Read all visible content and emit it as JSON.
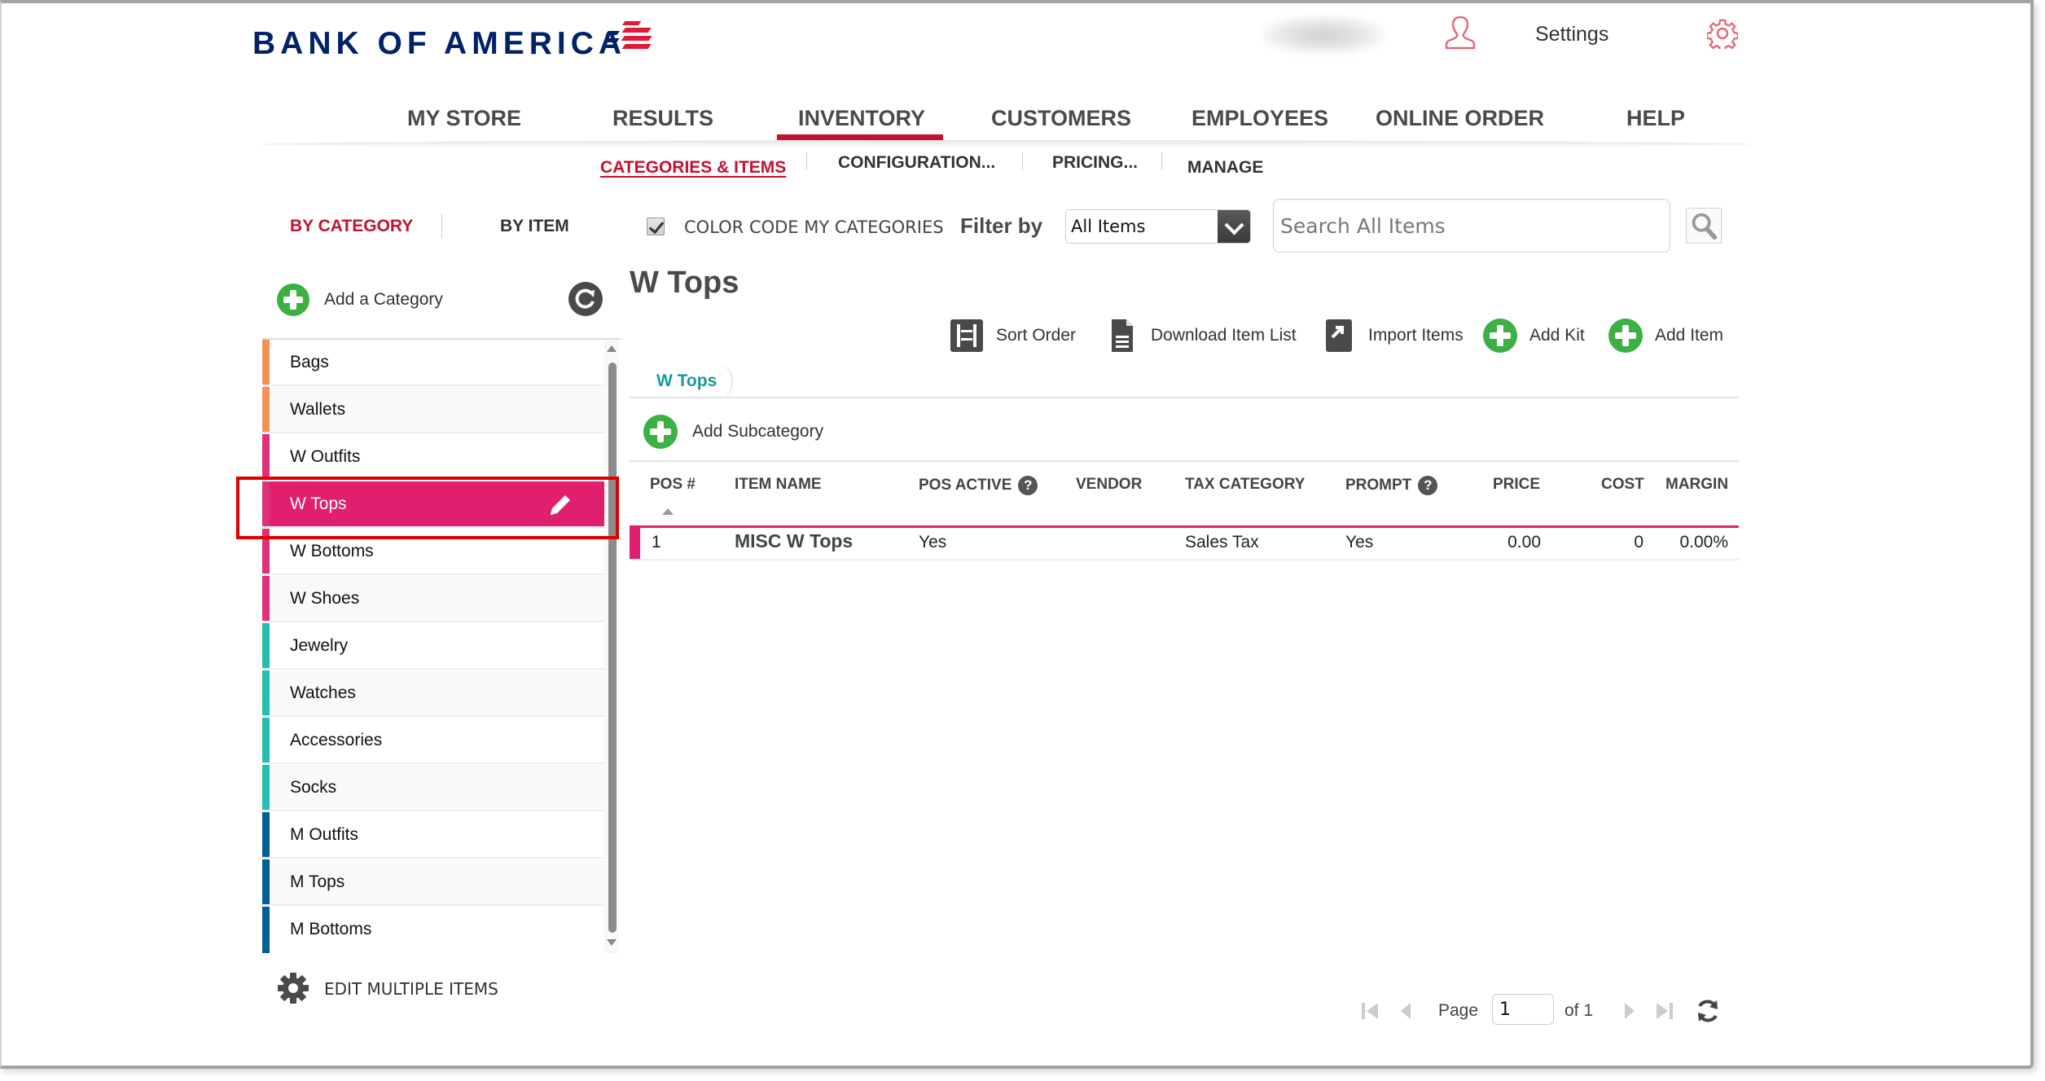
{
  "brand": {
    "name": "BANK OF AMERICA",
    "colors": {
      "navy": "#012169",
      "red": "#c41230",
      "pink": "#e0206f",
      "green": "#3cb043"
    }
  },
  "header": {
    "user_name_blurred": "",
    "settings_label": "Settings"
  },
  "main_nav": {
    "items": [
      {
        "label": "MY STORE",
        "active": false
      },
      {
        "label": "RESULTS",
        "active": false
      },
      {
        "label": "INVENTORY",
        "active": true
      },
      {
        "label": "CUSTOMERS",
        "active": false
      },
      {
        "label": "EMPLOYEES",
        "active": false
      },
      {
        "label": "ONLINE ORDER",
        "active": false
      },
      {
        "label": "HELP",
        "active": false
      }
    ]
  },
  "sub_nav": {
    "items": [
      {
        "label": "CATEGORIES & ITEMS",
        "active": true
      },
      {
        "label": "CONFIGURATION...",
        "active": false
      },
      {
        "label": "PRICING...",
        "active": false
      },
      {
        "label": "MANAGE",
        "active": false
      }
    ]
  },
  "view_tabs": {
    "by_category": "BY CATEGORY",
    "by_item": "BY ITEM",
    "active": "BY CATEGORY"
  },
  "color_code": {
    "label": "COLOR CODE MY CATEGORIES",
    "checked": true
  },
  "filter": {
    "label": "Filter by",
    "selected": "All Items"
  },
  "search": {
    "placeholder": "Search All Items",
    "value": ""
  },
  "sidebar": {
    "add_category_label": "Add a Category",
    "categories": [
      {
        "label": "Bags",
        "color": "#f58f54",
        "selected": false
      },
      {
        "label": "Wallets",
        "color": "#f58f54",
        "selected": false
      },
      {
        "label": "W Outfits",
        "color": "#e0307a",
        "selected": false
      },
      {
        "label": "W Tops",
        "color": "#e0307a",
        "selected": true
      },
      {
        "label": "W Bottoms",
        "color": "#e0307a",
        "selected": false
      },
      {
        "label": "W Shoes",
        "color": "#e0307a",
        "selected": false
      },
      {
        "label": "Jewelry",
        "color": "#22bfae",
        "selected": false
      },
      {
        "label": "Watches",
        "color": "#22bfae",
        "selected": false
      },
      {
        "label": "Accessories",
        "color": "#22bfae",
        "selected": false
      },
      {
        "label": "Socks",
        "color": "#22bfae",
        "selected": false
      },
      {
        "label": "M Outfits",
        "color": "#005f96",
        "selected": false
      },
      {
        "label": "M Tops",
        "color": "#005f96",
        "selected": false
      },
      {
        "label": "M Bottoms",
        "color": "#005f96",
        "selected": false
      }
    ],
    "edit_multiple_label": "EDIT MULTIPLE ITEMS"
  },
  "main": {
    "title": "W Tops",
    "toolbar": {
      "sort_order": "Sort Order",
      "download_item_list": "Download Item List",
      "import_items": "Import Items",
      "add_kit": "Add Kit",
      "add_item": "Add Item"
    },
    "breadcrumb": "W Tops",
    "add_subcategory_label": "Add Subcategory",
    "table": {
      "columns": [
        "POS #",
        "ITEM NAME",
        "POS ACTIVE",
        "VENDOR",
        "TAX CATEGORY",
        "PROMPT",
        "PRICE",
        "COST",
        "MARGIN"
      ],
      "help_glyph": "?",
      "rows": [
        {
          "pos": "1",
          "item_name": "MISC W Tops",
          "pos_active": "Yes",
          "vendor": "",
          "tax_category": "Sales Tax",
          "prompt": "Yes",
          "price": "0.00",
          "cost": "0",
          "margin": "0.00%"
        }
      ]
    }
  },
  "pagination": {
    "page_label": "Page",
    "current_page": "1",
    "of_label": "of 1"
  }
}
